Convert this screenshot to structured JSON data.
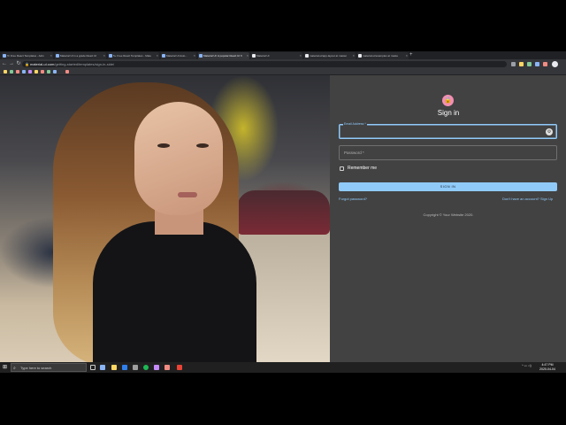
{
  "browser": {
    "tabs": [
      {
        "label": "Tc Free React Templates - Adm",
        "active": false
      },
      {
        "label": "Material UI in a grade React UI",
        "active": false
      },
      {
        "label": "5+ Free React Templates - Mate",
        "active": false
      },
      {
        "label": "Material UI Auto...",
        "active": false
      },
      {
        "label": "Material UI: A popular React UI fr",
        "active": true
      },
      {
        "label": "Material UI",
        "active": false
      },
      {
        "label": "material-ui/app-layout at master",
        "active": false
      },
      {
        "label": "material-ui/examples at maste",
        "active": false
      }
    ],
    "new_tab": "+",
    "back": "←",
    "forward": "→",
    "reload": "↻",
    "url_domain": "material-ui.com",
    "url_path": "/getting-started/templates/sign-in-side/",
    "lock_icon": "🔒"
  },
  "page": {
    "avatar_icon": "lock-icon",
    "title": "Sign in",
    "email_legend": "Email Address *",
    "email_value": "",
    "password_placeholder": "Password *",
    "password_value": "",
    "remember_label": "Remember me",
    "submit_label": "SIGN IN",
    "forgot_link": "Forgot password?",
    "signup_link": "Don't have an account? Sign Up",
    "copyright": "Copyright © Your Website 2020.",
    "colors": {
      "primary": "#90caf9",
      "avatar": "#f48fb1",
      "panel": "#424242"
    }
  },
  "taskbar": {
    "search_placeholder": "Type here to search",
    "time": "4:47 PM",
    "date": "2020-04-04"
  }
}
